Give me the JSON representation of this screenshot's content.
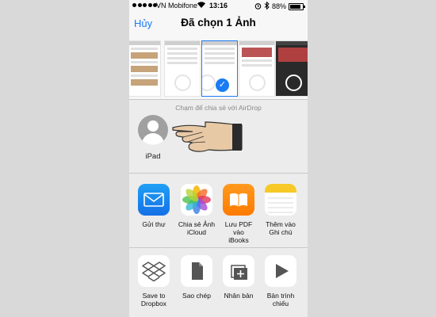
{
  "status_bar": {
    "carrier": "VN Mobifone",
    "time": "13:16",
    "battery": "88%",
    "battery_level": 0.88,
    "icons": [
      "wifi-icon",
      "alarm-icon",
      "bluetooth-icon",
      "battery-icon"
    ]
  },
  "nav": {
    "cancel": "Hủy",
    "title": "Đã chọn 1 Ảnh"
  },
  "photos": {
    "count_selected": 1
  },
  "airdrop": {
    "hint": "Chạm để chia sẻ với AirDrop",
    "device_name": "iPad",
    "pointer_icon": "pointing-hand-icon"
  },
  "share_apps": [
    {
      "label": "Gửi thư",
      "icon": "mail-icon"
    },
    {
      "label": "Chia sẻ Ảnh\niCloud",
      "icon": "photos-icon"
    },
    {
      "label": "Lưu PDF vào\niBooks",
      "icon": "ibooks-icon"
    },
    {
      "label": "Thêm vào\nGhi chú",
      "icon": "notes-icon"
    }
  ],
  "actions": [
    {
      "label": "Save to\nDropbox",
      "icon": "dropbox-icon"
    },
    {
      "label": "Sao chép",
      "icon": "copy-icon"
    },
    {
      "label": "Nhân bản",
      "icon": "duplicate-icon"
    },
    {
      "label": "Bản trình\nchiếu",
      "icon": "slideshow-icon"
    }
  ],
  "colors": {
    "accent": "#1a7cf5",
    "sheet_bg": "#ececec"
  }
}
